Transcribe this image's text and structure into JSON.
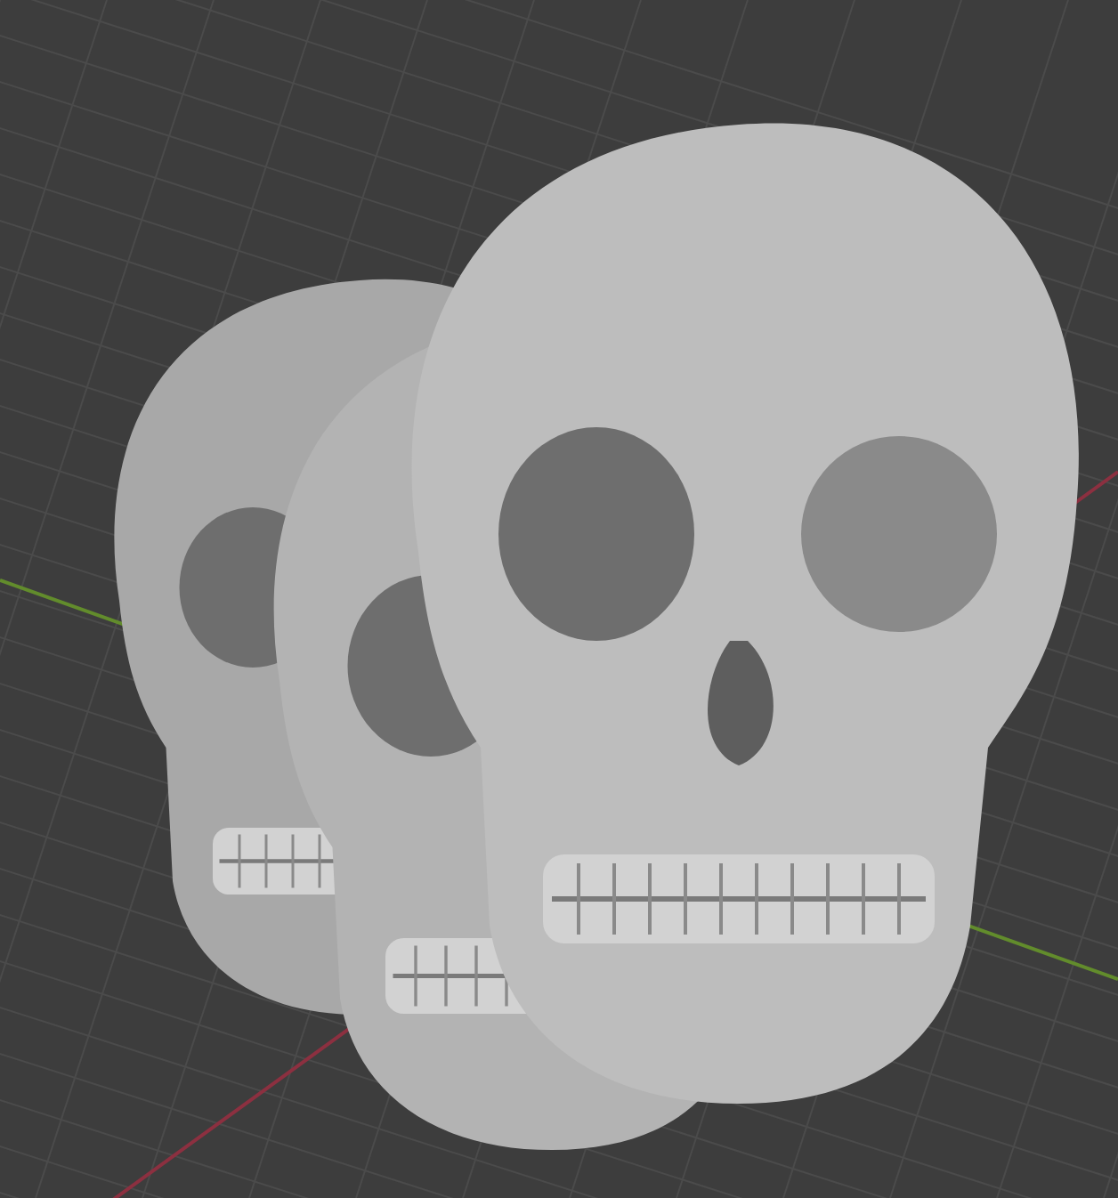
{
  "viewport": {
    "axes": [
      {
        "kind": "x",
        "color": "#8c3040"
      },
      {
        "kind": "y",
        "color": "#628c2c"
      }
    ]
  }
}
